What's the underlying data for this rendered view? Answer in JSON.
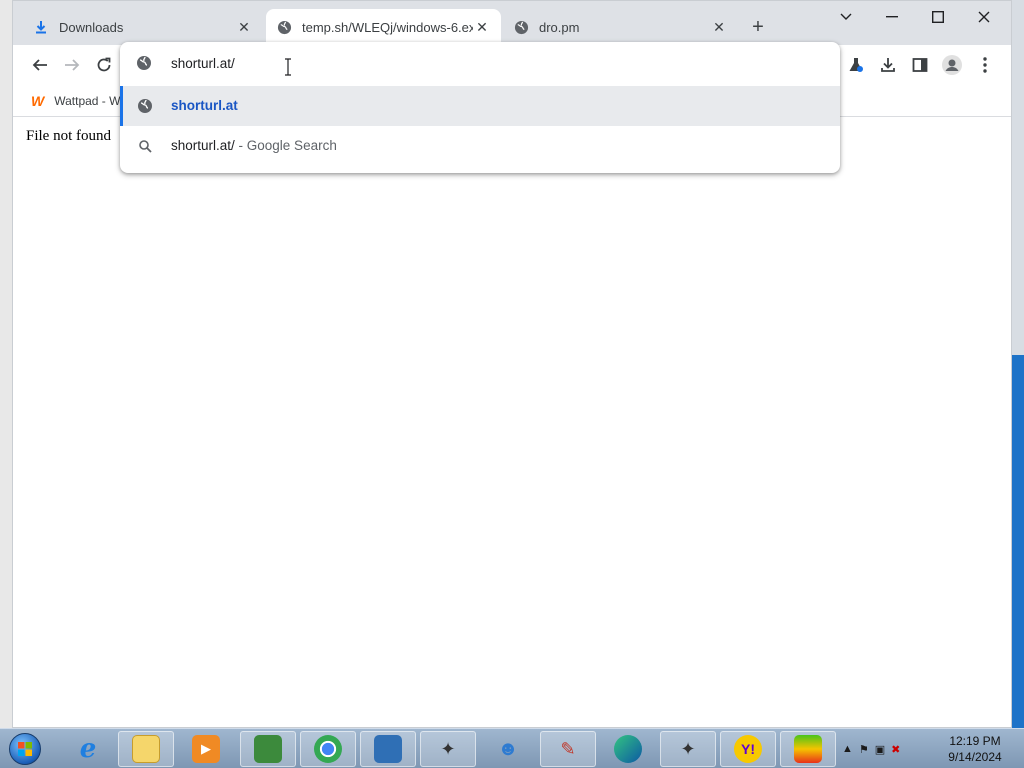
{
  "tabs": [
    {
      "title": "Downloads",
      "icon": "download-icon",
      "active": false
    },
    {
      "title": "temp.sh/WLEQj/windows-6.exe",
      "icon": "globe-icon",
      "active": true
    },
    {
      "title": "dro.pm",
      "icon": "globe-icon",
      "active": false
    }
  ],
  "bookmarks": {
    "item1": {
      "label": "Wattpad - W",
      "icon_text": "W"
    }
  },
  "omnibox": {
    "value": "shorturl.at/",
    "suggestions": [
      {
        "text": "shorturl.at",
        "icon": "globe-icon"
      },
      {
        "query": "shorturl.at/",
        "suffix": " - Google Search",
        "icon": "search-icon"
      }
    ]
  },
  "page": {
    "message": "File not found"
  },
  "clock": {
    "time": "12:19 PM",
    "date": "9/14/2024"
  },
  "colors": {
    "accent": "#1a73e8",
    "selected_suggestion_text": "#1a56c4",
    "tabstrip": "#dee1e6"
  }
}
